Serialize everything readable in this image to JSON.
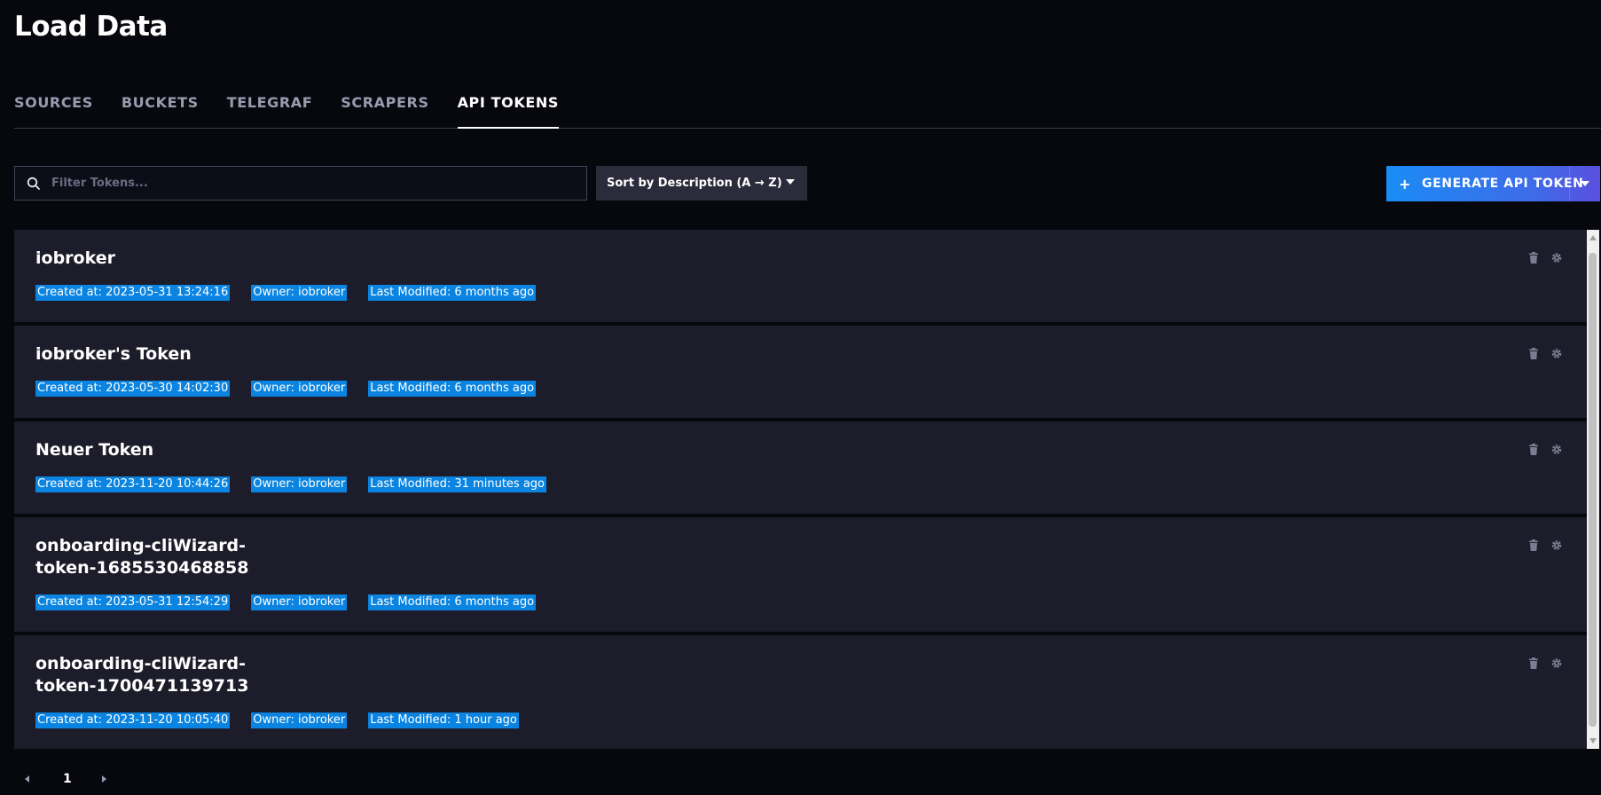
{
  "page": {
    "title": "Load Data"
  },
  "tabs": [
    {
      "label": "SOURCES",
      "active": false
    },
    {
      "label": "BUCKETS",
      "active": false
    },
    {
      "label": "TELEGRAF",
      "active": false
    },
    {
      "label": "SCRAPERS",
      "active": false
    },
    {
      "label": "API TOKENS",
      "active": true
    }
  ],
  "toolbar": {
    "search_placeholder": "Filter Tokens...",
    "search_value": "",
    "sort_label": "Sort by Description (A → Z)",
    "generate_label": "GENERATE API TOKEN"
  },
  "tokens": [
    {
      "name": "iobroker",
      "created": "Created at: 2023-05-31 13:24:16",
      "owner": "Owner: iobroker",
      "modified": "Last Modified: 6 months ago"
    },
    {
      "name": "iobroker's Token",
      "created": "Created at: 2023-05-30 14:02:30",
      "owner": "Owner: iobroker",
      "modified": "Last Modified: 6 months ago"
    },
    {
      "name": "Neuer Token",
      "created": "Created at: 2023-11-20 10:44:26",
      "owner": "Owner: iobroker",
      "modified": "Last Modified: 31 minutes ago"
    },
    {
      "name": "onboarding-cliWizard-token-1685530468858",
      "created": "Created at: 2023-05-31 12:54:29",
      "owner": "Owner: iobroker",
      "modified": "Last Modified: 6 months ago"
    },
    {
      "name": "onboarding-cliWizard-token-1700471139713",
      "created": "Created at: 2023-11-20 10:05:40",
      "owner": "Owner: iobroker",
      "modified": "Last Modified: 1 hour ago"
    }
  ],
  "pagination": {
    "current_page": "1"
  },
  "colors": {
    "background": "#07070e",
    "card": "#1c1c2a",
    "selection_highlight": "#0a84e0",
    "button_gradient_start": "#1a8cf4",
    "button_gradient_end": "#5a4fdf"
  },
  "icons": {
    "search": "search-icon",
    "delete": "trash-icon",
    "settings": "gear-icon",
    "sort_caret": "chevron-down-icon",
    "add": "plus-icon"
  }
}
